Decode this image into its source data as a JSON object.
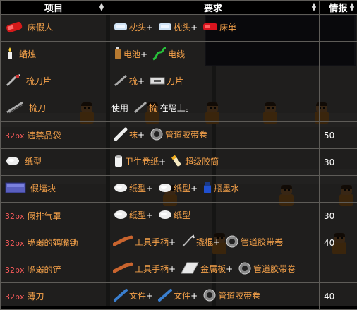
{
  "table": {
    "headers": {
      "item": "项目",
      "requirement": "要求",
      "intel": "情报"
    },
    "rows": [
      {
        "prefix": "",
        "name": "床假人",
        "icon": "bed-dummy-icon",
        "recipe": [
          {
            "icon": "pillow-icon",
            "text": "枕头",
            "sep": "+"
          },
          {
            "icon": "pillow-icon",
            "text": "枕头",
            "sep": "+"
          },
          {
            "icon": "bedsheet-icon",
            "text": "床单",
            "sep": ""
          }
        ],
        "intel": ""
      },
      {
        "prefix": "",
        "name": "蜡烛",
        "icon": "candle-icon",
        "recipe": [
          {
            "icon": "battery-icon",
            "text": "电池",
            "sep": "+"
          },
          {
            "icon": "wire-icon",
            "text": "电线",
            "sep": ""
          }
        ],
        "intel": ""
      },
      {
        "prefix": "",
        "name": "梳刀片",
        "icon": "comb-blade-icon",
        "recipe": [
          {
            "icon": "comb-icon",
            "text": "梳",
            "sep": "+"
          },
          {
            "icon": "razor-blade-icon",
            "text": "刀片",
            "sep": ""
          }
        ],
        "intel": ""
      },
      {
        "prefix": "",
        "name": "梳刀",
        "icon": "comb-shiv-icon",
        "recipe_prefix": "使用",
        "recipe_suffix": "在墙上。",
        "recipe": [
          {
            "icon": "comb-icon",
            "text": "梳",
            "sep": ""
          }
        ],
        "intel": ""
      },
      {
        "prefix": "32px",
        "name": "违禁品袋",
        "icon": "",
        "recipe": [
          {
            "icon": "sock-icon",
            "text": "袜",
            "sep": "+"
          },
          {
            "icon": "duct-tape-icon",
            "text": "管道胶带卷",
            "sep": ""
          }
        ],
        "intel": "50"
      },
      {
        "prefix": "",
        "name": "纸型",
        "icon": "paper-mache-icon",
        "recipe": [
          {
            "icon": "toilet-paper-icon",
            "text": "卫生卷纸",
            "sep": "+"
          },
          {
            "icon": "superglue-icon",
            "text": "超级胶筒",
            "sep": ""
          }
        ],
        "intel": "30"
      },
      {
        "prefix": "",
        "name": "假墙块",
        "icon": "fake-wall-block-icon",
        "recipe": [
          {
            "icon": "paper-mache-icon",
            "text": "纸型",
            "sep": "+"
          },
          {
            "icon": "paper-mache-icon",
            "text": "纸型",
            "sep": "+"
          },
          {
            "icon": "ink-icon",
            "text": "瓶墨水",
            "sep": ""
          }
        ],
        "intel": ""
      },
      {
        "prefix": "32px",
        "name": "假排气罩",
        "icon": "",
        "recipe": [
          {
            "icon": "paper-mache-icon",
            "text": "纸型",
            "sep": "+"
          },
          {
            "icon": "paper-mache-icon",
            "text": "纸型",
            "sep": ""
          }
        ],
        "intel": "30"
      },
      {
        "prefix": "32px",
        "name": "脆弱的鹤嘴锄",
        "icon": "",
        "recipe": [
          {
            "icon": "tool-handle-icon",
            "text": "工具手柄",
            "sep": "+"
          },
          {
            "icon": "crowbar-icon",
            "text": "撬棍",
            "sep": "+"
          },
          {
            "icon": "duct-tape-icon",
            "text": "管道胶带卷",
            "sep": ""
          }
        ],
        "intel": "40"
      },
      {
        "prefix": "32px",
        "name": "脆弱的铲",
        "icon": "",
        "recipe": [
          {
            "icon": "tool-handle-icon",
            "text": "工具手柄",
            "sep": "+"
          },
          {
            "icon": "sheet-metal-icon",
            "text": "金属板",
            "sep": "+"
          },
          {
            "icon": "duct-tape-icon",
            "text": "管道胶带卷",
            "sep": ""
          }
        ],
        "intel": ""
      },
      {
        "prefix": "32px",
        "name": "薄刀",
        "icon": "",
        "recipe": [
          {
            "icon": "file-icon",
            "text": "文件",
            "sep": "+"
          },
          {
            "icon": "file-icon",
            "text": "文件",
            "sep": "+"
          },
          {
            "icon": "duct-tape-icon",
            "text": "管道胶带卷",
            "sep": ""
          }
        ],
        "intel": "40"
      }
    ]
  },
  "colors": {
    "link": "#f6a24a",
    "px_text": "#ff5c5c",
    "header_bg": "#000000"
  }
}
